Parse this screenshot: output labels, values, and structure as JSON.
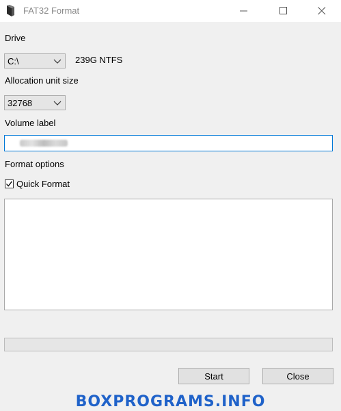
{
  "window": {
    "title": "FAT32 Format",
    "icons": {
      "app": "fat32-format-icon",
      "minimize": "minimize-icon",
      "maximize": "maximize-icon",
      "close": "close-icon"
    }
  },
  "drive": {
    "label": "Drive",
    "selected": "C:\\",
    "info": "239G NTFS"
  },
  "allocation": {
    "label": "Allocation unit size",
    "selected": "32768"
  },
  "volume": {
    "label": "Volume label",
    "value": ""
  },
  "format_options": {
    "label": "Format options",
    "quick_format_label": "Quick Format",
    "quick_format_checked": true
  },
  "progress": {
    "value_percent": 0
  },
  "buttons": {
    "start": "Start",
    "close": "Close"
  },
  "watermark": "BOXPROGRAMS.INFO",
  "colors": {
    "focus_border": "#0078d7",
    "watermark": "#1f62c9",
    "background": "#f0f0f0"
  }
}
